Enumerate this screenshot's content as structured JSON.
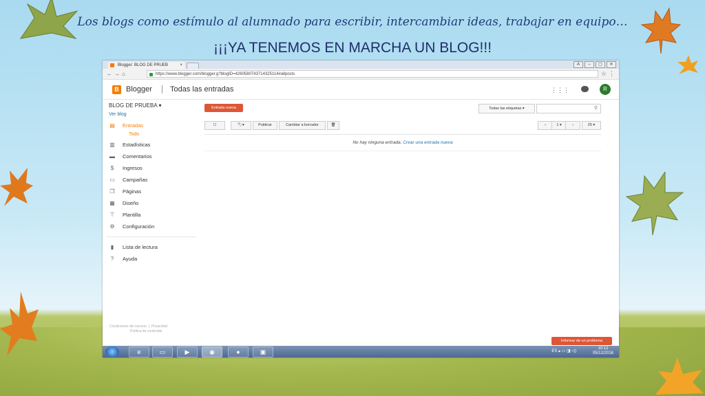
{
  "slide": {
    "title": "Los blogs como estímulo al alumnado para escribir, intercambiar ideas, trabajar en equipo…",
    "subtitle": "¡¡¡YA TENEMOS EN MARCHA UN BLOG!!!"
  },
  "browser": {
    "tab_title": "Blogger: BLOG DE PRUEB",
    "tab_close": "×",
    "url": "https://www.blogger.com/blogger.g?blogID=4260580743714325114#allposts",
    "window_controls": [
      "A",
      "–",
      "▢",
      "✕"
    ]
  },
  "header": {
    "logo_letter": "B",
    "brand": "Blogger",
    "page_title": "Todas las entradas",
    "avatar_letter": "R"
  },
  "sidebar": {
    "blog_name": "BLOG DE PRUEBA",
    "view_blog": "Ver blog",
    "items": [
      {
        "label": "Entradas",
        "icon": "posts-icon"
      },
      {
        "label": "Estadísticas",
        "icon": "stats-icon"
      },
      {
        "label": "Comentarios",
        "icon": "comments-icon"
      },
      {
        "label": "Ingresos",
        "icon": "dollar-icon"
      },
      {
        "label": "Campañas",
        "icon": "ads-icon"
      },
      {
        "label": "Páginas",
        "icon": "pages-icon"
      },
      {
        "label": "Diseño",
        "icon": "layout-icon"
      },
      {
        "label": "Plantilla",
        "icon": "template-icon"
      },
      {
        "label": "Configuración",
        "icon": "gear-icon"
      },
      {
        "label": "Lista de lectura",
        "icon": "bookmark-icon"
      },
      {
        "label": "Ayuda",
        "icon": "help-icon"
      }
    ],
    "sub_all": "Todo",
    "footer_terms": "Condiciones del servicio",
    "footer_privacy": "Privacidad",
    "footer_content": "Política de contenido"
  },
  "main": {
    "new_post": "Entrada nueva",
    "labels_filter": "Todas las etiquetas",
    "publish": "Publicar",
    "revert_draft": "Cambiar a borrador",
    "page_number": "1",
    "per_page": "25",
    "empty_text": "No hay ninguna entrada.",
    "create_link": "Crear una entrada nueva",
    "report": "Informar de un problema"
  },
  "taskbar": {
    "lang": "ES",
    "time": "10:12",
    "date": "05/12/2016"
  },
  "colors": {
    "accent": "#f57d00",
    "button": "#dd5636",
    "link": "#1a73a8"
  }
}
